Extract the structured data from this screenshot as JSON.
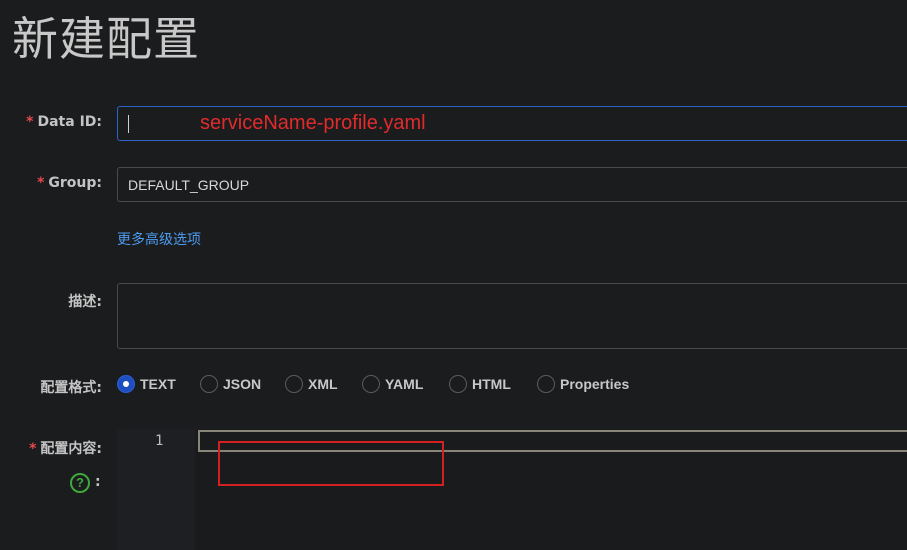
{
  "page": {
    "title": "新建配置"
  },
  "form": {
    "data_id": {
      "required": "*",
      "label": "Data ID:",
      "value": "",
      "hint_annotation": "serviceName-profile.yaml"
    },
    "group": {
      "required": "*",
      "label": "Group:",
      "value": "DEFAULT_GROUP"
    },
    "advanced_link": "更多高级选项",
    "description": {
      "label": "描述:",
      "value": ""
    },
    "format": {
      "label": "配置格式:",
      "options": [
        "TEXT",
        "JSON",
        "XML",
        "YAML",
        "HTML",
        "Properties"
      ],
      "selected": "TEXT"
    },
    "content": {
      "required": "*",
      "label": "配置内容:",
      "line_numbers": [
        "1"
      ],
      "help_icon_glyph": "?",
      "help_colon": ":"
    }
  },
  "colors": {
    "required": "#e5484d",
    "link": "#4c9bf0",
    "annotation": "#e12b2b",
    "radio_selected": "#1f4fbf",
    "help_icon": "#3ea83e"
  }
}
